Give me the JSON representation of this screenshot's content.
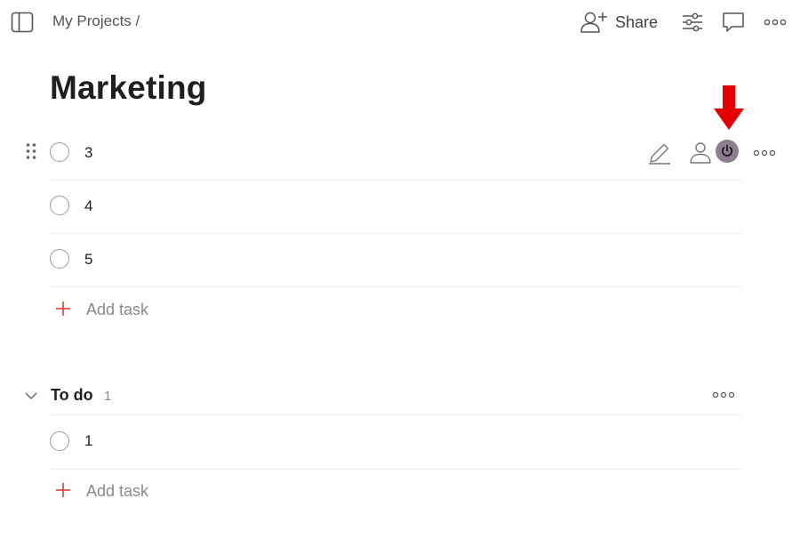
{
  "header": {
    "breadcrumb": "My Projects /",
    "share_label": "Share"
  },
  "page": {
    "title": "Marketing"
  },
  "tasks": [
    {
      "label": "3"
    },
    {
      "label": "4"
    },
    {
      "label": "5"
    }
  ],
  "add_task_label": "Add task",
  "section": {
    "title": "To do",
    "count": "1",
    "tasks": [
      {
        "label": "1"
      }
    ],
    "add_task_label": "Add task"
  },
  "colors": {
    "accent_red": "#db4035",
    "annotation_red": "#e50000",
    "hover_avatar": "#8c7d8f"
  }
}
